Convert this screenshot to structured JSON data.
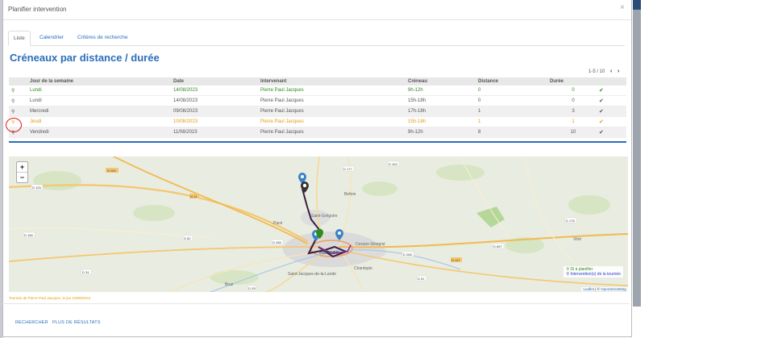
{
  "modal": {
    "title": "Planifier intervention",
    "close": "×"
  },
  "tabs": [
    {
      "label": "Liste"
    },
    {
      "label": "Calendrier"
    },
    {
      "label": "Critères de recherche"
    }
  ],
  "heading": "Créneaux par distance / durée",
  "pager": {
    "text": "1-5 / 10",
    "prev": "‹",
    "next": "›"
  },
  "table": {
    "columns": [
      "Jour de la semaine",
      "Date",
      "Intervenant",
      "Créneau",
      "Distance",
      "Durée"
    ],
    "rows": [
      {
        "day": "Lundi",
        "date": "14/08/2023",
        "tech": "Pierre Paul Jacques",
        "slot": "9h-12h",
        "distance": "0",
        "duration": "0",
        "check": "✔"
      },
      {
        "day": "Lundi",
        "date": "14/08/2023",
        "tech": "Pierre Paul Jacques",
        "slot": "15h-18h",
        "distance": "0",
        "duration": "0",
        "check": "✔"
      },
      {
        "day": "Mercredi",
        "date": "09/08/2023",
        "tech": "Pierre Paul Jacques",
        "slot": "17h-18h",
        "distance": "1",
        "duration": "3",
        "check": "✔"
      },
      {
        "day": "Jeudi",
        "date": "10/08/2023",
        "tech": "Pierre Paul Jacques",
        "slot": "15h-18h",
        "distance": "1",
        "duration": "1",
        "check": "✔"
      },
      {
        "day": "Vendredi",
        "date": "11/08/2023",
        "tech": "Pierre Paul Jacques",
        "slot": "9h-12h",
        "distance": "8",
        "duration": "10",
        "check": "✔"
      }
    ]
  },
  "map": {
    "zoom_in": "+",
    "zoom_out": "−",
    "labels": [
      "Rennes",
      "Saint-Grégoire",
      "Betton",
      "Cesson-Sévigné",
      "Chantepie",
      "Pacé",
      "Saint-Jacques-de-la-Lande",
      "Bruz",
      "Vitré"
    ],
    "roads": [
      "N 164",
      "D 125",
      "N 12",
      "D 82",
      "D 286",
      "D 288",
      "D 177",
      "D 857",
      "N 157",
      "D 29",
      "D 178",
      "D 163",
      "D 92",
      "D 34",
      "D 166"
    ],
    "legend": {
      "item1": "Di à planifier",
      "item2": "Intervention(s) de la tournée"
    },
    "attribution": {
      "leaflet": "Leaflet",
      "sep": " | © ",
      "osm": "OpenStreetMap"
    }
  },
  "caption": "Tournée de Pierre Paul Jacques, le jeu 10/08/2023",
  "footer": {
    "search": "RECHERCHER",
    "more": "PLUS DE RÉSULTATS"
  },
  "colors": {
    "accent": "#2a6ebb",
    "green": "#2f8a1f",
    "orange": "#e59a10",
    "route": "#3b1f3f",
    "route2": "#8a2aa0",
    "highlight": "#e01b1b"
  },
  "icons": {
    "pin": "map-pin-icon",
    "check": "check-icon",
    "close": "close-icon"
  }
}
